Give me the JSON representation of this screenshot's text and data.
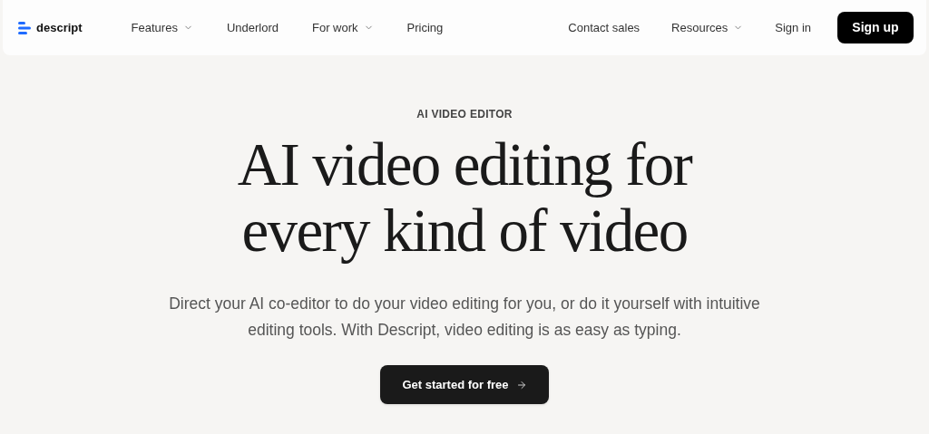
{
  "header": {
    "logo": "descript",
    "nav": [
      {
        "label": "Features",
        "kind": "dropdown"
      },
      {
        "label": "Underlord",
        "kind": "link"
      },
      {
        "label": "For work",
        "kind": "dropdown"
      },
      {
        "label": "Pricing",
        "kind": "link"
      }
    ],
    "right_nav": [
      {
        "label": "Contact sales",
        "kind": "link"
      },
      {
        "label": "Resources",
        "kind": "dropdown"
      },
      {
        "label": "Sign in",
        "kind": "link"
      }
    ],
    "signup": "Sign up"
  },
  "hero": {
    "eyebrow": "AI VIDEO EDITOR",
    "title": "AI video editing for every kind of video",
    "subtitle": "Direct your AI co-editor to do your video editing for you, or do it yourself with intuitive editing tools. With Descript, video editing is as easy as typing.",
    "cta": "Get started for free"
  }
}
